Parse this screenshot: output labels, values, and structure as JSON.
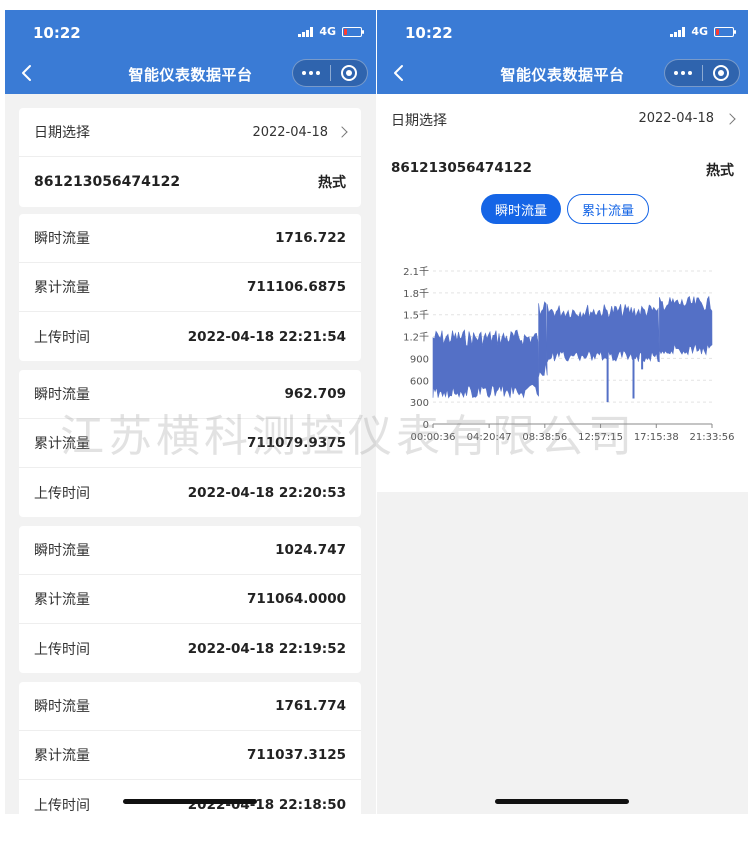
{
  "status": {
    "time": "10:22",
    "network": "4G"
  },
  "nav": {
    "title": "智能仪表数据平台"
  },
  "date_picker": {
    "label": "日期选择",
    "value": "2022-04-18"
  },
  "device": {
    "id": "861213056474122",
    "type": "热式"
  },
  "labels": {
    "instant": "瞬时流量",
    "total": "累计流量",
    "upload": "上传时间"
  },
  "records": [
    {
      "instant": "1716.722",
      "total": "711106.6875",
      "time": "2022-04-18 22:21:54"
    },
    {
      "instant": "962.709",
      "total": "711079.9375",
      "time": "2022-04-18 22:20:53"
    },
    {
      "instant": "1024.747",
      "total": "711064.0000",
      "time": "2022-04-18 22:19:52"
    },
    {
      "instant": "1761.774",
      "total": "711037.3125",
      "time": "2022-04-18 22:18:50"
    }
  ],
  "tabs": {
    "instant": "瞬时流量",
    "total": "累计流量"
  },
  "watermark": "江苏横科测控仪表有限公司",
  "colors": {
    "primary": "#3a7bd5",
    "accent": "#1565e6",
    "series": "#5470c6"
  },
  "chart_data": {
    "type": "area",
    "yticks": [
      "0",
      "300",
      "600",
      "900",
      "1.2千",
      "1.5千",
      "1.8千",
      "2.1千"
    ],
    "ylim": [
      0,
      2100
    ],
    "xticks": [
      "00:00:36",
      "04:20:47",
      "08:38:56",
      "12:57:15",
      "17:15:38",
      "21:33:56"
    ],
    "grid": "horizontal",
    "series": [
      {
        "segments": [
          {
            "from": "00:00:36",
            "to": "08:10:00",
            "low": 360,
            "high": 1300
          },
          {
            "from": "08:10:00",
            "to": "08:50:00",
            "low": 650,
            "high": 1750
          },
          {
            "from": "08:50:00",
            "to": "17:30:00",
            "low": 850,
            "high": 1650
          },
          {
            "from": "17:30:00",
            "to": "21:33:56",
            "low": 950,
            "high": 1750
          }
        ],
        "dips": [
          {
            "time": "13:30:00",
            "value": 300
          },
          {
            "time": "15:30:00",
            "value": 350
          },
          {
            "time": "16:10:00",
            "value": 750
          }
        ]
      }
    ]
  }
}
